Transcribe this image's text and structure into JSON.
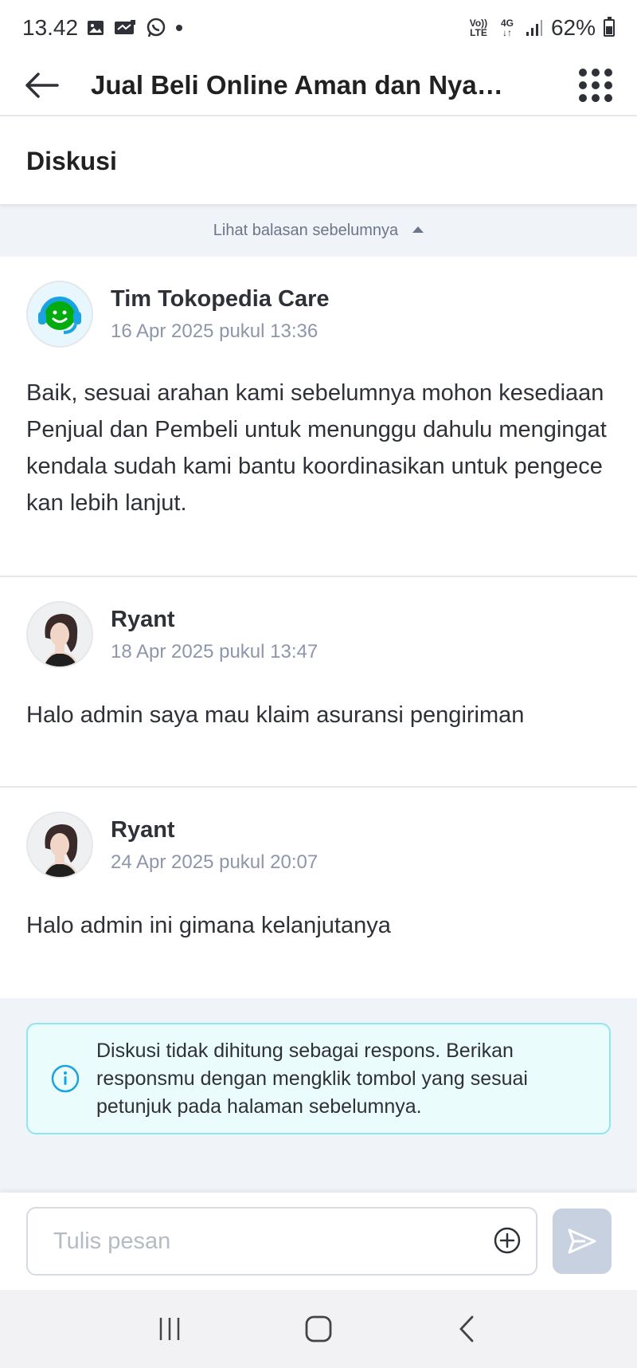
{
  "status_bar": {
    "time": "13.42",
    "net_top": "Vo))",
    "net_bottom": "LTE",
    "net_type": "4G",
    "battery": "62%",
    "icons": [
      "gallery-icon",
      "sync-icon",
      "whatsapp-icon",
      "dot-icon",
      "signal-icon",
      "battery-icon"
    ]
  },
  "header": {
    "title": "Jual Beli Online Aman dan Nyaman",
    "back_icon": "arrow-left-icon",
    "menu_icon": "grid-menu-icon"
  },
  "section": {
    "title": "Diskusi"
  },
  "load_previous": {
    "label": "Lihat balasan sebelumnya"
  },
  "messages": [
    {
      "author": "Tim Tokopedia Care",
      "time": "16 Apr 2025 pukul 13:36",
      "text": "Baik, sesuai arahan kami sebelumnya mohon kesediaan Penjual dan Pembeli untuk menunggu dahulu mengingat kendala sudah kami bantu koordinasikan untuk pengecekan lebih lanjut."
    },
    {
      "author": "Ryant",
      "time": "18 Apr 2025 pukul 13:47",
      "text": "Halo admin saya mau klaim asuransi pengiriman"
    },
    {
      "author": "Ryant",
      "time": "24 Apr 2025 pukul 20:07",
      "text": "Halo admin ini gimana kelanjutanya"
    }
  ],
  "info": {
    "text": "Diskusi tidak dihitung sebagai respons. Berikan responsmu dengan mengklik tombol yang sesuai petunjuk pada halaman sebelumnya."
  },
  "composer": {
    "placeholder": "Tulis pesan",
    "value": ""
  },
  "colors": {
    "tokopedia_green": "#03ac0e",
    "care_blue": "#1aa3e0",
    "info_border": "#8ee6ee",
    "info_bg": "#ebfcfd",
    "send_disabled": "#c8d1e0"
  }
}
